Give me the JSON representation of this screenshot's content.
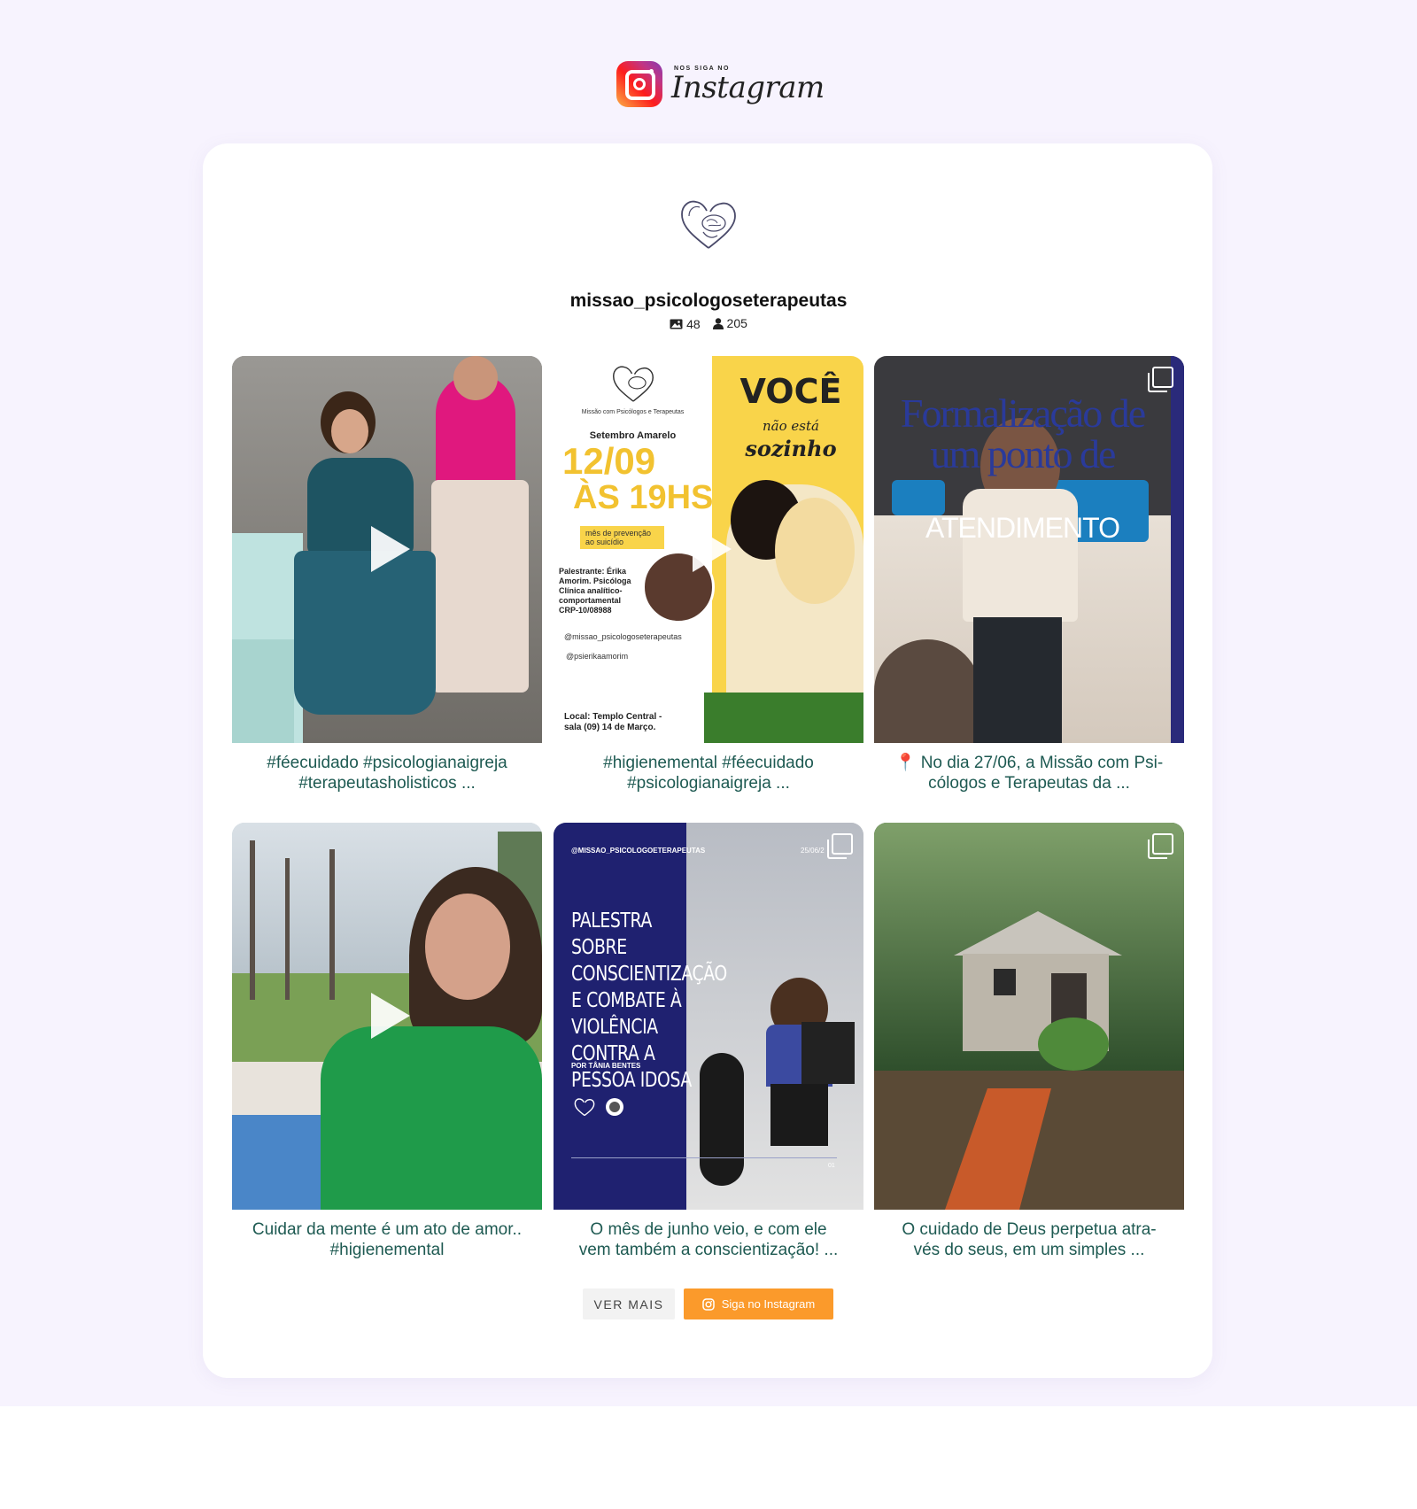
{
  "header": {
    "logo_small": "NOS SIGA NO",
    "logo_word": "Instagram"
  },
  "profile": {
    "username": "missao_psicologoseterapeutas",
    "posts_count": "48",
    "followers_count": "205"
  },
  "posts": [
    {
      "caption_1": "#féecuidado #psicologianaigreja",
      "caption_2": "#terapeutasholisticos ...",
      "type": "video"
    },
    {
      "caption_1": "#higienemental #féecuidado",
      "caption_2": "#psicologianaigreja ...",
      "type": "video",
      "overlay": {
        "org": "Missão com Psicólogos e Terapeutas",
        "event": "Setembro Amarelo",
        "date": "12/09",
        "time": "ÀS 19HS",
        "tag": "mês de prevenção ao suicídio",
        "voce": "VOCÊ",
        "nao_esta": "não está",
        "sozinho": "sozinho",
        "speaker": "Palestrante: Érika Amorim. Psicóloga Clínica analítico-comportamental CRP-10/08988",
        "handle1": "@missao_psicologoseterapeutas",
        "handle2": "@psierikaamorim",
        "local": "Local: Templo Central - sala (09) 14 de Março."
      }
    },
    {
      "caption_1": "📍 No dia 27/06, a Missão com Psi-",
      "caption_2": "cólogos e Terapeutas da ...",
      "type": "carousel",
      "overlay": {
        "line1": "Formalização de",
        "line2": "um ponto de",
        "line3": "ATENDIMENTO"
      }
    },
    {
      "caption_1": "Cuidar da mente é um ato de amor..",
      "caption_2": "#higienemental",
      "type": "video"
    },
    {
      "caption_1": "O mês de junho veio, e com ele",
      "caption_2": "vem também a conscientização! ...",
      "type": "carousel",
      "overlay": {
        "handle": "@MISSAO_PSICOLOGOETERAPEUTAS",
        "date": "25/06/2",
        "title": "PALESTRA SOBRE CONSCIENTIZAÇÃO E COMBATE À VIOLÊNCIA CONTRA A PESSOA IDOSA",
        "by": "POR TÂNIA BENTES",
        "page": "01"
      }
    },
    {
      "caption_1": "O cuidado de Deus perpetua atra-",
      "caption_2": "vés do seus, em um simples ...",
      "type": "carousel"
    }
  ],
  "buttons": {
    "more": "VER MAIS",
    "follow": "Siga no Instagram"
  },
  "colors": {
    "background": "#f7f3fe",
    "caption": "#1e5a52",
    "follow_button": "#fb9a2b"
  }
}
